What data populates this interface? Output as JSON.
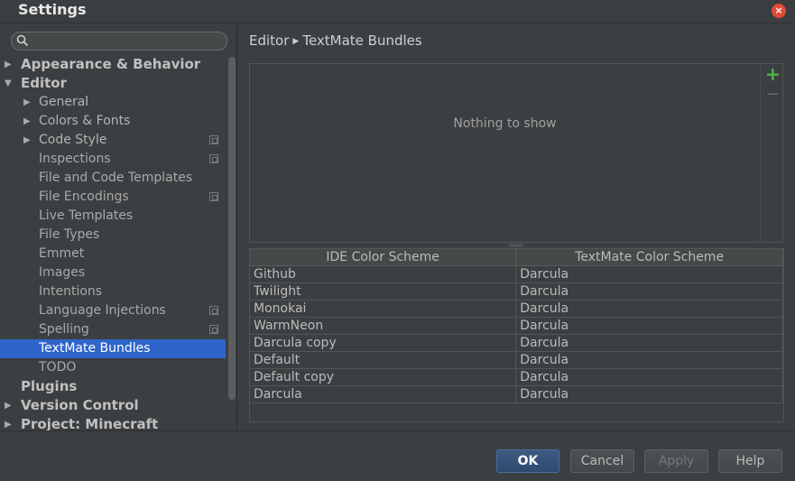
{
  "window": {
    "title": "Settings",
    "close_symbol": "×"
  },
  "search": {
    "placeholder": "",
    "value": ""
  },
  "tree": [
    {
      "label": "Appearance & Behavior",
      "level": 0,
      "arrow": "▶",
      "project": false,
      "selected": false
    },
    {
      "label": "Editor",
      "level": 0,
      "arrow": "▼",
      "project": false,
      "selected": false
    },
    {
      "label": "General",
      "level": 1,
      "arrow": "▶",
      "project": false,
      "selected": false
    },
    {
      "label": "Colors & Fonts",
      "level": 1,
      "arrow": "▶",
      "project": false,
      "selected": false
    },
    {
      "label": "Code Style",
      "level": 1,
      "arrow": "▶",
      "project": true,
      "selected": false
    },
    {
      "label": "Inspections",
      "level": 1,
      "arrow": "",
      "project": true,
      "selected": false
    },
    {
      "label": "File and Code Templates",
      "level": 1,
      "arrow": "",
      "project": false,
      "selected": false
    },
    {
      "label": "File Encodings",
      "level": 1,
      "arrow": "",
      "project": true,
      "selected": false
    },
    {
      "label": "Live Templates",
      "level": 1,
      "arrow": "",
      "project": false,
      "selected": false
    },
    {
      "label": "File Types",
      "level": 1,
      "arrow": "",
      "project": false,
      "selected": false
    },
    {
      "label": "Emmet",
      "level": 1,
      "arrow": "",
      "project": false,
      "selected": false
    },
    {
      "label": "Images",
      "level": 1,
      "arrow": "",
      "project": false,
      "selected": false
    },
    {
      "label": "Intentions",
      "level": 1,
      "arrow": "",
      "project": false,
      "selected": false
    },
    {
      "label": "Language Injections",
      "level": 1,
      "arrow": "",
      "project": true,
      "selected": false
    },
    {
      "label": "Spelling",
      "level": 1,
      "arrow": "",
      "project": true,
      "selected": false
    },
    {
      "label": "TextMate Bundles",
      "level": 1,
      "arrow": "",
      "project": false,
      "selected": true
    },
    {
      "label": "TODO",
      "level": 1,
      "arrow": "",
      "project": false,
      "selected": false
    },
    {
      "label": "Plugins",
      "level": 0,
      "arrow": "",
      "project": false,
      "selected": false
    },
    {
      "label": "Version Control",
      "level": 0,
      "arrow": "▶",
      "project": false,
      "selected": false
    },
    {
      "label": "Project: Minecraft",
      "level": 0,
      "arrow": "▶",
      "project": false,
      "selected": false
    }
  ],
  "breadcrumb": {
    "parent": "Editor",
    "separator": "▶",
    "current": "TextMate Bundles"
  },
  "bundles": {
    "empty_text": "Nothing to show",
    "add_symbol": "+",
    "remove_symbol": "−"
  },
  "scheme_table": {
    "headers": [
      "IDE Color Scheme",
      "TextMate Color Scheme"
    ],
    "rows": [
      [
        "Github",
        "Darcula"
      ],
      [
        "Twilight",
        "Darcula"
      ],
      [
        "Monokai",
        "Darcula"
      ],
      [
        "WarmNeon",
        "Darcula"
      ],
      [
        "Darcula copy",
        "Darcula"
      ],
      [
        "Default",
        "Darcula"
      ],
      [
        "Default copy",
        "Darcula"
      ],
      [
        "Darcula",
        "Darcula"
      ]
    ]
  },
  "buttons": {
    "ok": "OK",
    "cancel": "Cancel",
    "apply": "Apply",
    "help": "Help"
  },
  "colors": {
    "selection": "#2f65ca",
    "add_icon": "#4fb84b",
    "close": "#e14a38",
    "background": "#3c3f41"
  }
}
